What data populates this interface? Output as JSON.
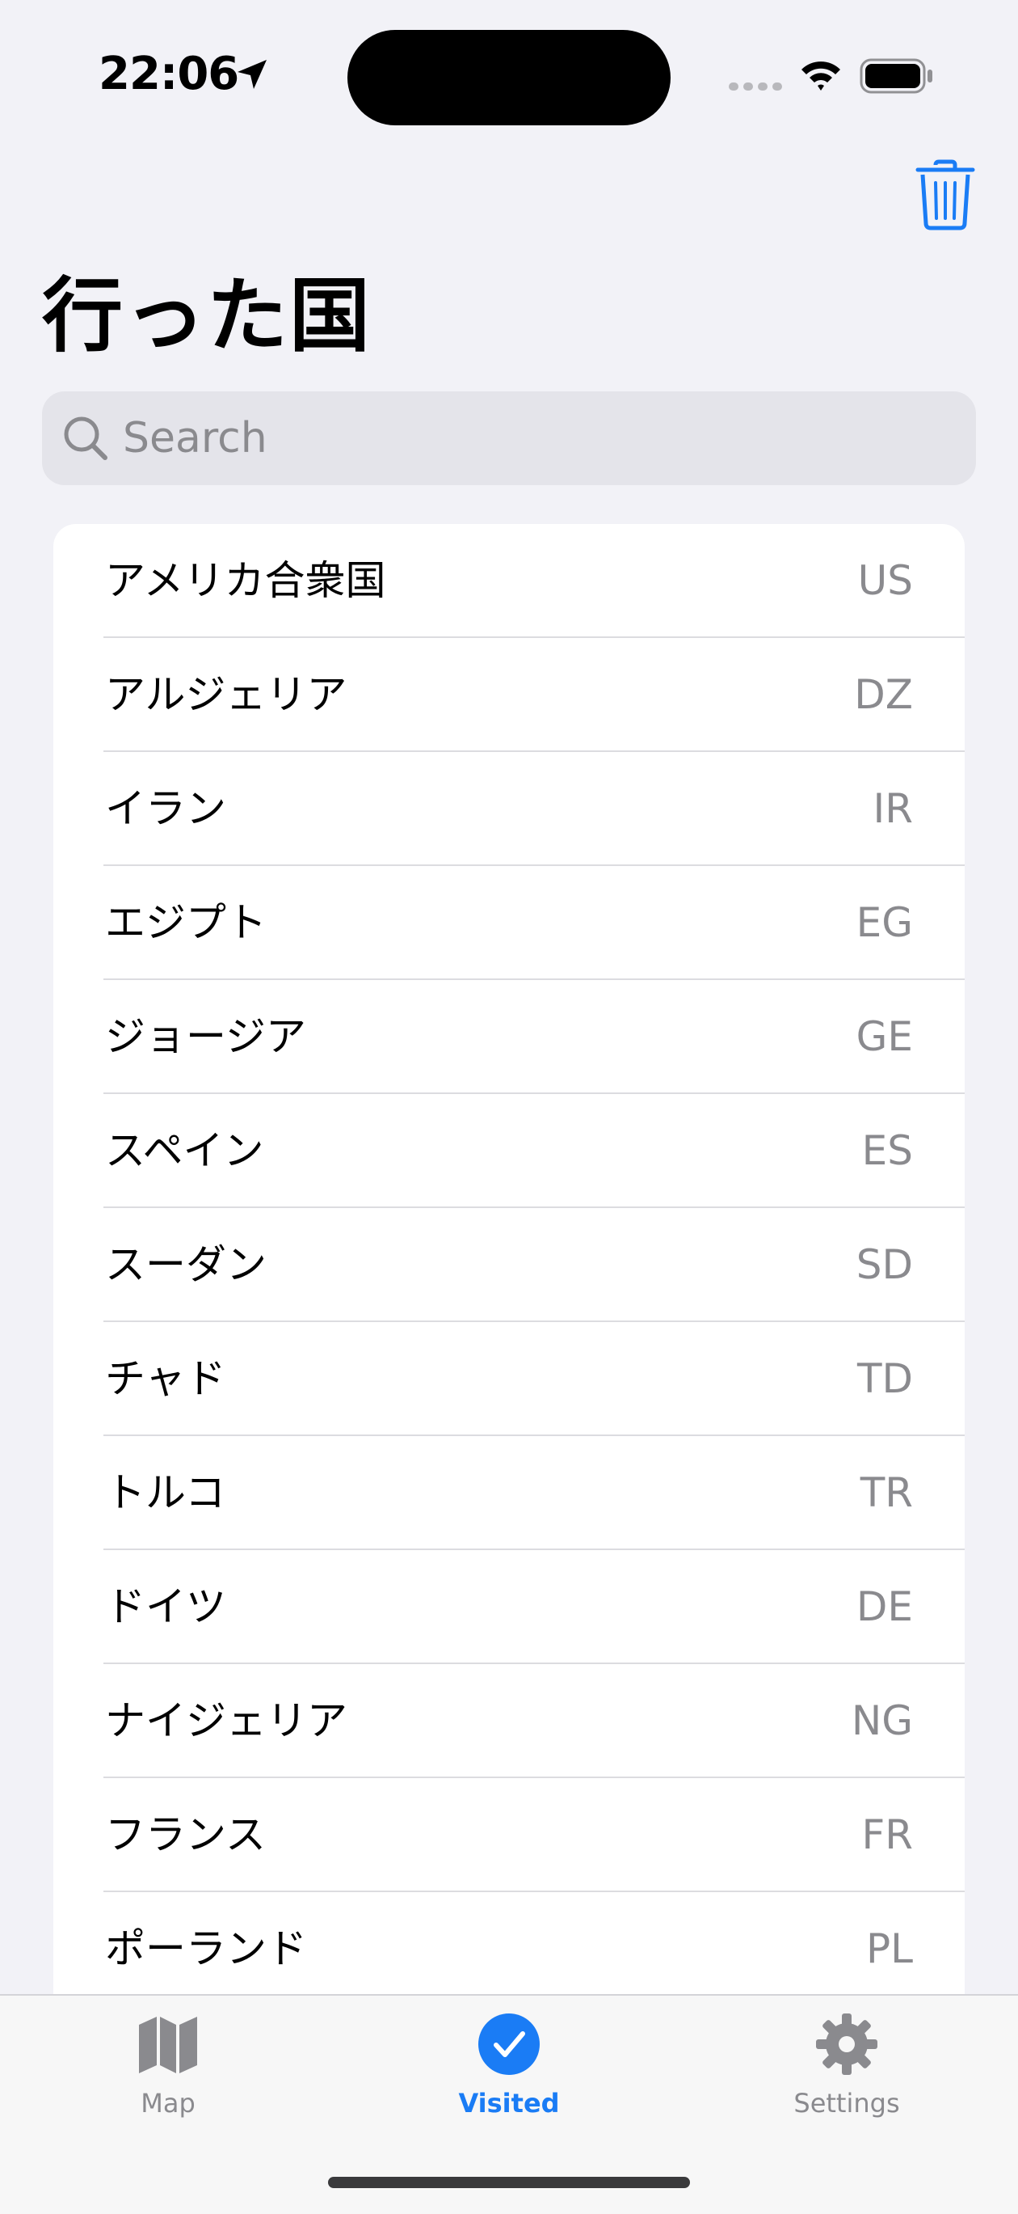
{
  "status_bar": {
    "time": "22:06"
  },
  "toolbar": {
    "trash_icon": "trash-icon"
  },
  "header": {
    "title": "行った国"
  },
  "search": {
    "placeholder": "Search",
    "value": ""
  },
  "countries": [
    {
      "name": "アメリカ合衆国",
      "code": "US"
    },
    {
      "name": "アルジェリア",
      "code": "DZ"
    },
    {
      "name": "イラン",
      "code": "IR"
    },
    {
      "name": "エジプト",
      "code": "EG"
    },
    {
      "name": "ジョージア",
      "code": "GE"
    },
    {
      "name": "スペイン",
      "code": "ES"
    },
    {
      "name": "スーダン",
      "code": "SD"
    },
    {
      "name": "チャド",
      "code": "TD"
    },
    {
      "name": "トルコ",
      "code": "TR"
    },
    {
      "name": "ドイツ",
      "code": "DE"
    },
    {
      "name": "ナイジェリア",
      "code": "NG"
    },
    {
      "name": "フランス",
      "code": "FR"
    },
    {
      "name": "ポーランド",
      "code": "PL"
    }
  ],
  "tabs": [
    {
      "label": "Map",
      "icon": "map-icon"
    },
    {
      "label": "Visited",
      "icon": "checkmark-circle-icon"
    },
    {
      "label": "Settings",
      "icon": "gear-icon"
    }
  ],
  "colors": {
    "accent": "#1a7cf5",
    "inactive": "#8a8a8e",
    "background": "#f2f2f7"
  }
}
